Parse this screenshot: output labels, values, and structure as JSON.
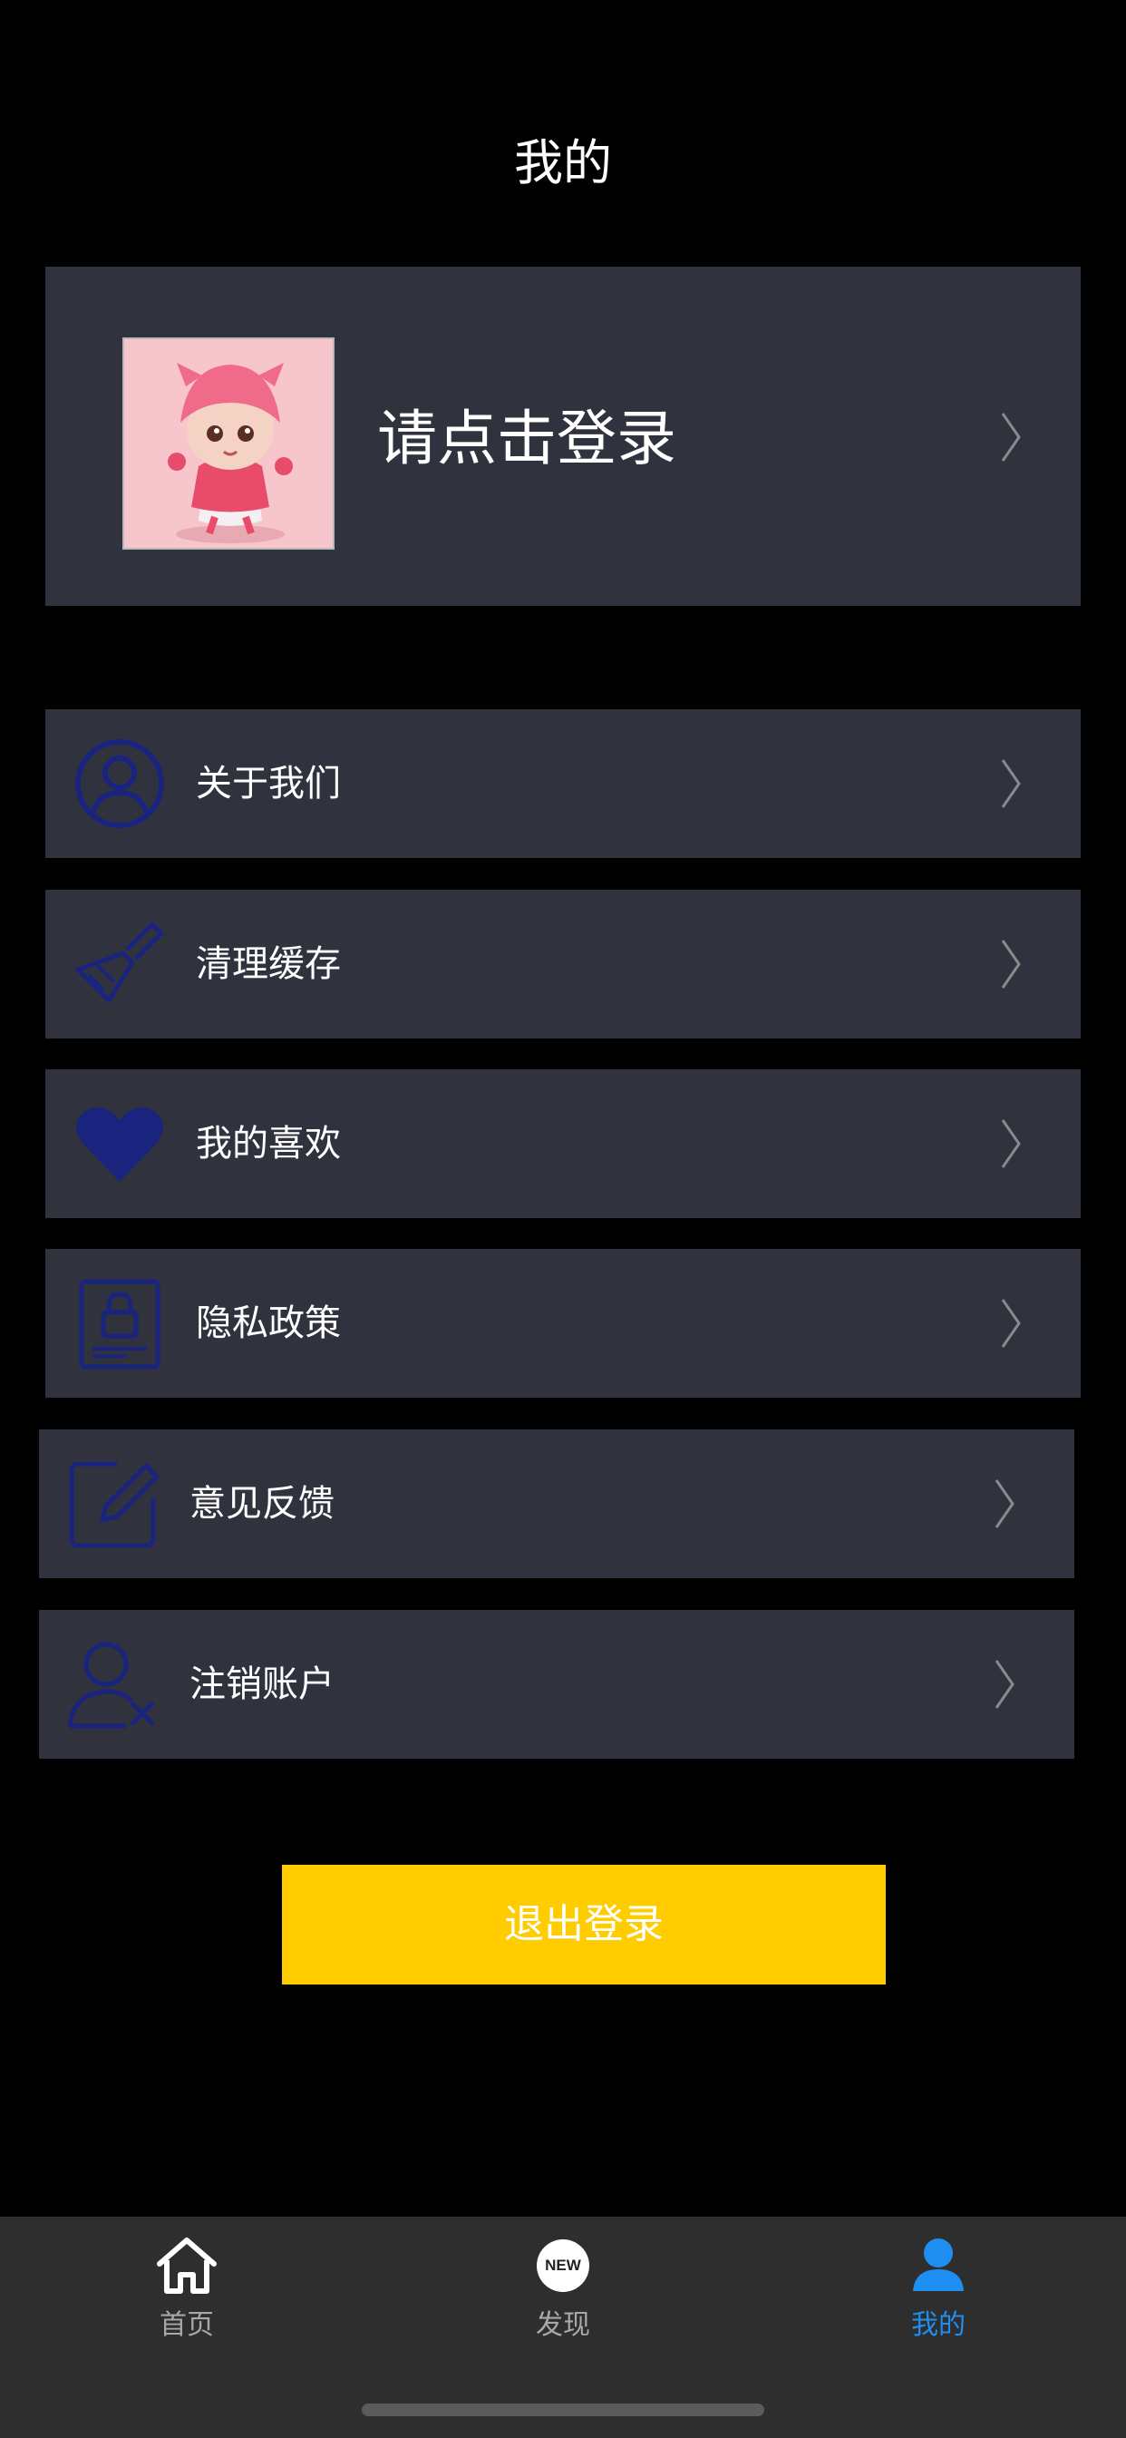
{
  "header": {
    "title": "我的"
  },
  "profile": {
    "login_prompt": "请点击登录",
    "avatar_icon": "avatar-image"
  },
  "menu": {
    "items": [
      {
        "label": "关于我们",
        "icon": "user-circle-icon"
      },
      {
        "label": "清理缓存",
        "icon": "brush-icon"
      },
      {
        "label": "我的喜欢",
        "icon": "heart-icon"
      },
      {
        "label": "隐私政策",
        "icon": "lock-document-icon"
      },
      {
        "label": "意见反馈",
        "icon": "edit-icon"
      },
      {
        "label": "注销账户",
        "icon": "user-remove-icon"
      }
    ]
  },
  "logout": {
    "label": "退出登录"
  },
  "tabbar": {
    "tabs": [
      {
        "label": "首页",
        "icon": "home-icon",
        "active": false
      },
      {
        "label": "发现",
        "icon": "new-badge-icon",
        "active": false
      },
      {
        "label": "我的",
        "icon": "person-icon",
        "active": true
      }
    ],
    "new_badge_text": "NEW"
  },
  "colors": {
    "background": "#000000",
    "card": "#30333e",
    "icon": "#1a237e",
    "accent": "#ffcc00",
    "active_tab": "#1e8ff0",
    "inactive_tab": "#a8a8a8"
  }
}
